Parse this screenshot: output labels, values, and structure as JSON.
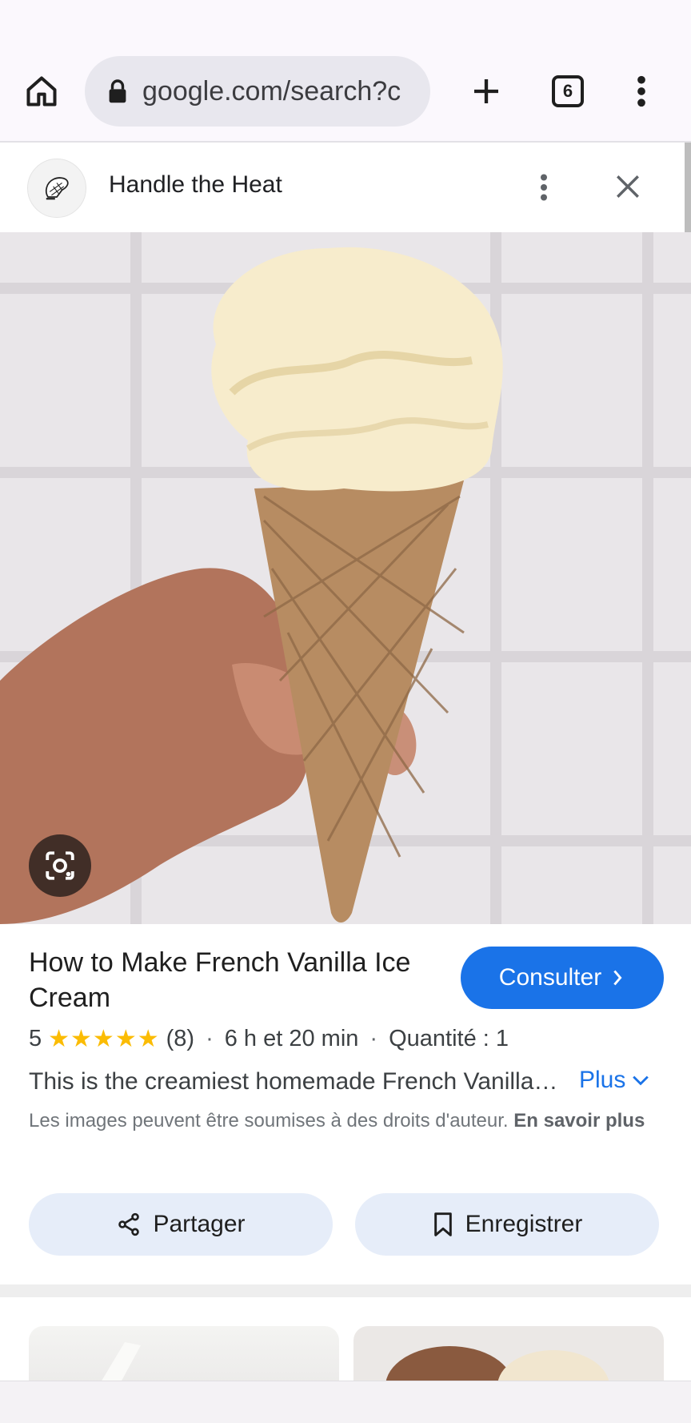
{
  "browser": {
    "url": "google.com/search?c",
    "tab_count": "6",
    "icons": {
      "home": "home-icon",
      "lock": "lock-icon",
      "new_tab": "plus-icon",
      "menu": "more-vert-icon"
    }
  },
  "source": {
    "name": "Handle the Heat",
    "icons": {
      "avatar": "oven-mitt-logo",
      "more": "more-vert-icon",
      "close": "close-icon"
    }
  },
  "result": {
    "title": "How to Make French Vanilla Ice Cream",
    "consult_label": "Consulter",
    "rating_value": "5",
    "stars": "★★★★★",
    "review_count": "(8)",
    "dot": "·",
    "duration": "6 h et 20 min",
    "quantity": "Quantité : 1",
    "description": "This is the creamiest homemade French Vanilla Ice Cream recipe you'll ever make!",
    "more_label": "Plus",
    "copyright_text": "Les images peuvent être soumises à des droits d'auteur.",
    "learn_more": "En savoir plus"
  },
  "actions": {
    "share_label": "Partager",
    "save_label": "Enregistrer"
  },
  "colors": {
    "accent": "#1a73e8",
    "star": "#fbbc04",
    "action_bg": "#e6edf9"
  }
}
